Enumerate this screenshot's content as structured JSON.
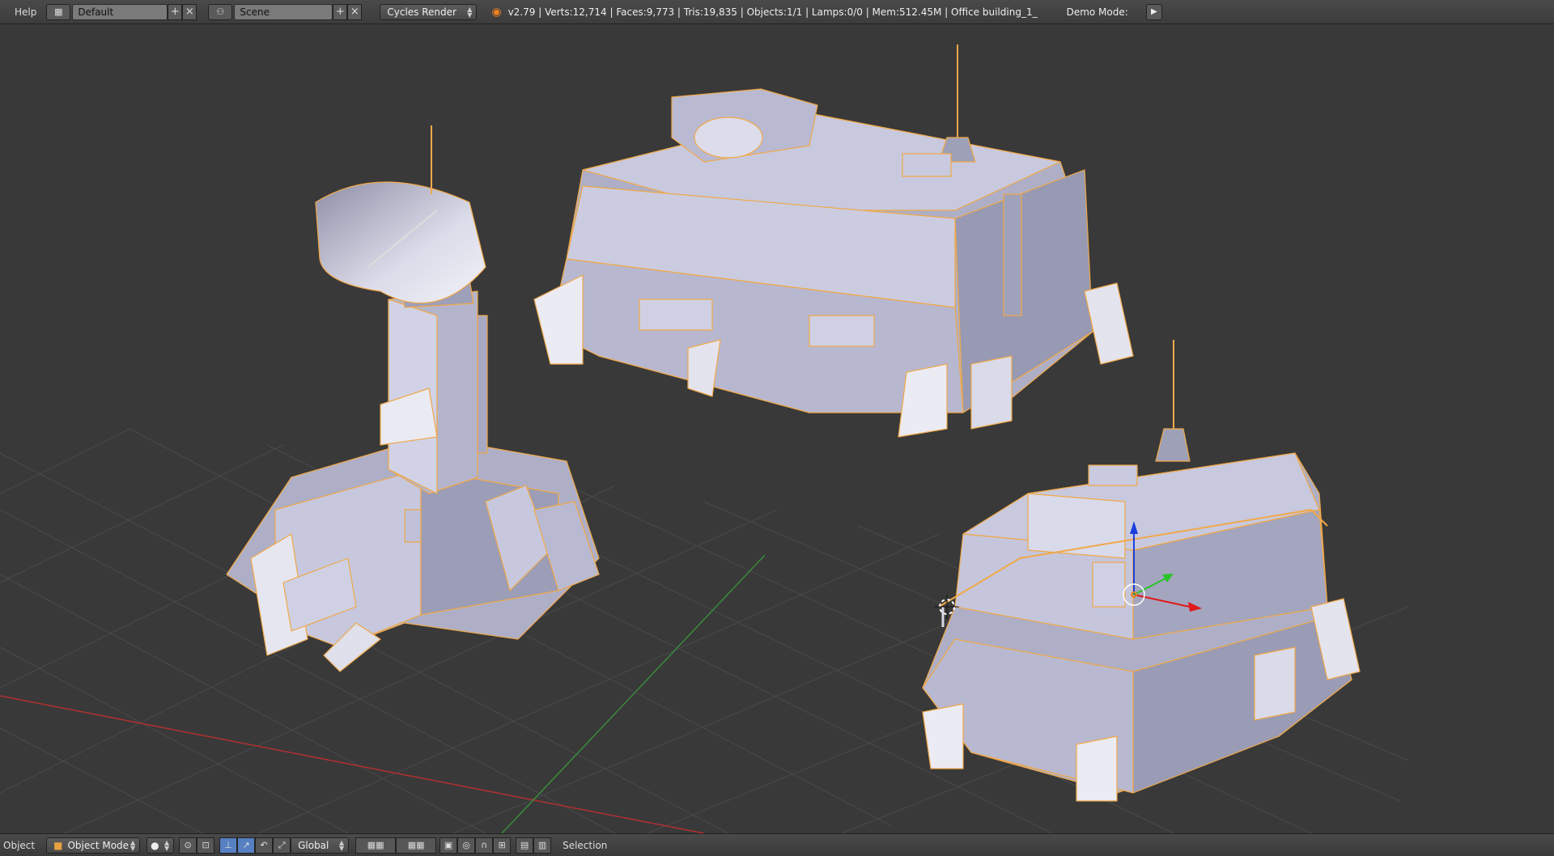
{
  "topbar": {
    "help_menu": "Help",
    "layout": {
      "value": "Default",
      "add_icon": "plus-icon",
      "remove_icon": "close-icon"
    },
    "scene": {
      "value": "Scene",
      "add_icon": "plus-icon",
      "remove_icon": "close-icon"
    },
    "render_engine": "Cycles Render",
    "stats": "v2.79 | Verts:12,714 | Faces:9,773 | Tris:19,835 | Objects:1/1 | Lamps:0/0 | Mem:512.45M | Office building_1_",
    "demo_mode": "Demo Mode:",
    "play_icon": "play-icon"
  },
  "bottombar": {
    "object_menu": "Object",
    "mode": "Object Mode",
    "orientation": "Global",
    "selection_label": "Selection"
  },
  "colors": {
    "background": "#393939",
    "selection_outline": "#f0a848",
    "building_light": "#d2d3e8",
    "building_mid": "#b5b6cf",
    "building_dark": "#8f90a8",
    "x_axis": "#b33030",
    "y_axis": "#3a8a3a",
    "gizmo_z": "#1a3ee0",
    "gizmo_x": "#e01a1a",
    "gizmo_y": "#2bc42b"
  }
}
